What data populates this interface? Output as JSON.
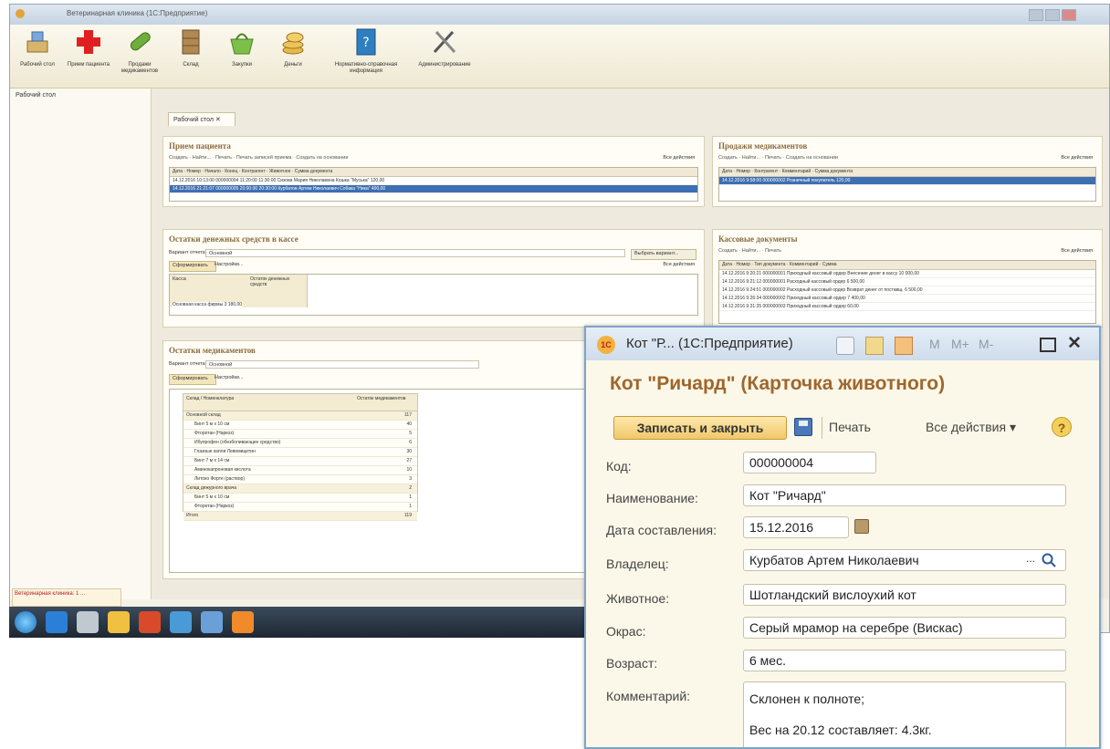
{
  "main": {
    "title": "Ветеринарная клиника (1С:Предприятие)",
    "toolbar": [
      {
        "label": "Рабочий стол",
        "icon": "desk-icon"
      },
      {
        "label": "Прием пациента",
        "icon": "red-cross-icon"
      },
      {
        "label": "Продажи медикаментов",
        "icon": "pill-icon"
      },
      {
        "label": "Склад",
        "icon": "warehouse-icon"
      },
      {
        "label": "Закупки",
        "icon": "basket-icon"
      },
      {
        "label": "Деньги",
        "icon": "coins-icon"
      },
      {
        "label": "Нормативно-справочная информация",
        "icon": "reference-icon"
      },
      {
        "label": "Администрирование",
        "icon": "tools-icon"
      }
    ],
    "left_pane_title": "Рабочий стол",
    "tab_label": "Рабочий стол",
    "panels": {
      "reception": {
        "title": "Прием пациента",
        "bar": "Создать · Найти... · Печать · Печать записей приема · Создать на основании",
        "all_actions": "Все действия",
        "columns": "Дата · Номер · Начало · Конец · Контрагент · Животное · Сумма документа",
        "rows": [
          "14.12.2016 10:13:00   000000004   11:20:00   11:30:00   Сизова Мария Николаевна   Кошка \"Муська\"   120,00",
          "14.12.2016 21:21:07   000000005   20:00:00   20:30:00   Курбатов Артем Николаевич   Собака \"Ника\"   400,00"
        ]
      },
      "sales": {
        "title": "Продажи медикаментов",
        "bar": "Создать · Найти... · Печать · Создать на основании",
        "all_actions": "Все действия",
        "columns": "Дата · Номер · Контрагент · Комментарий · Сумма документа",
        "rows": [
          "14.12.2016 9:58:00   000000002   Розничный покупатель   120,00"
        ]
      },
      "cash": {
        "title": "Остатки денежных средств в кассе",
        "variant_label": "Вариант отчета:",
        "variant_value": "Основной",
        "choose_variant": "Выбрать вариант...",
        "form_btn": "Сформировать",
        "settings": "Настройки...",
        "all_actions": "Все действия",
        "col1": "Касса",
        "col2": "Остаток денежных средств",
        "row": "Основная касса фирмы   3 180,00"
      },
      "cashdocs": {
        "title": "Кассовые документы",
        "bar": "Создать · Найти... · Печать",
        "all_actions": "Все действия",
        "columns": "Дата · Номер · Тип документа · Комментарий · Сумма",
        "rows": [
          "14.12.2016 9:20:21   000000001   Приходный кассовый ордер   Внесение денег в кассу   10 000,00",
          "14.12.2016 9:21:12   000000001   Расходный кассовый ордер   6 500,00",
          "14.12.2016 9:24:51   000000002   Расходный кассовый ордер   Возврат денег от поставщ.   6 500,00",
          "14.12.2016 9:26:34   000000002   Приходный кассовый ордер   7 400,00",
          "14.12.2016 9:31:35   000000003   Приходный кассовый ордер   60,00"
        ]
      },
      "stock": {
        "title": "Остатки медикаментов",
        "variant_label": "Вариант отчета:",
        "variant_value": "Основной",
        "form_btn": "Сформировать",
        "settings": "Настройки...",
        "col1": "Склад / Номенклатура",
        "col2": "Остаток медикаментов",
        "rows": [
          [
            "Основной склад",
            "117"
          ],
          [
            "Бинт 5 м x 10 см",
            "40"
          ],
          [
            "Фторотан (Наркоз)",
            "5"
          ],
          [
            "Ибупрофен (обезболивающее средство)",
            "6"
          ],
          [
            "Глазные капли Левомицетин",
            "30"
          ],
          [
            "Бинт 7 м x 14 см",
            "27"
          ],
          [
            "Аминокапроновая кислота",
            "10"
          ],
          [
            "Литоко Форте (раствор)",
            "3"
          ],
          [
            "Склад дежурного врача",
            "2"
          ],
          [
            "Бинт 5 м x 10 см",
            "1"
          ],
          [
            "Фторотан (Наркоз)",
            "1"
          ],
          [
            "Итого",
            "119"
          ]
        ]
      }
    },
    "notification": "Ветеринарная клиника: 1 ..."
  },
  "dialog": {
    "title": "Кот \"Р... (1С:Предприятие)",
    "mem_buttons": [
      "M",
      "M+",
      "M-"
    ],
    "heading": "Кот \"Ричард\" (Карточка животного)",
    "save_close": "Записать и закрыть",
    "print": "Печать",
    "all_actions": "Все действия",
    "fields": [
      {
        "label": "Код:",
        "value": "000000004"
      },
      {
        "label": "Наименование:",
        "value": "Кот \"Ричард\""
      },
      {
        "label": "Дата составления:",
        "value": "15.12.2016"
      },
      {
        "label": "Владелец:",
        "value": "Курбатов Артем Николаевич"
      },
      {
        "label": "Животное:",
        "value": "Шотландский вислоухий кот"
      },
      {
        "label": "Окрас:",
        "value": "Серый мрамор на серебре (Вискас)"
      },
      {
        "label": "Возраст:",
        "value": "6 мес."
      }
    ],
    "comment_label": "Комментарий:",
    "comment_lines": [
      "Склонен к полноте;",
      "Вес на 20.12 составляет: 4.3кг."
    ],
    "ellipsis": "...",
    "help": "?"
  },
  "colors": {
    "accent": "#a0662c",
    "selection": "#3d6fb3",
    "button": "#f1c86a"
  }
}
